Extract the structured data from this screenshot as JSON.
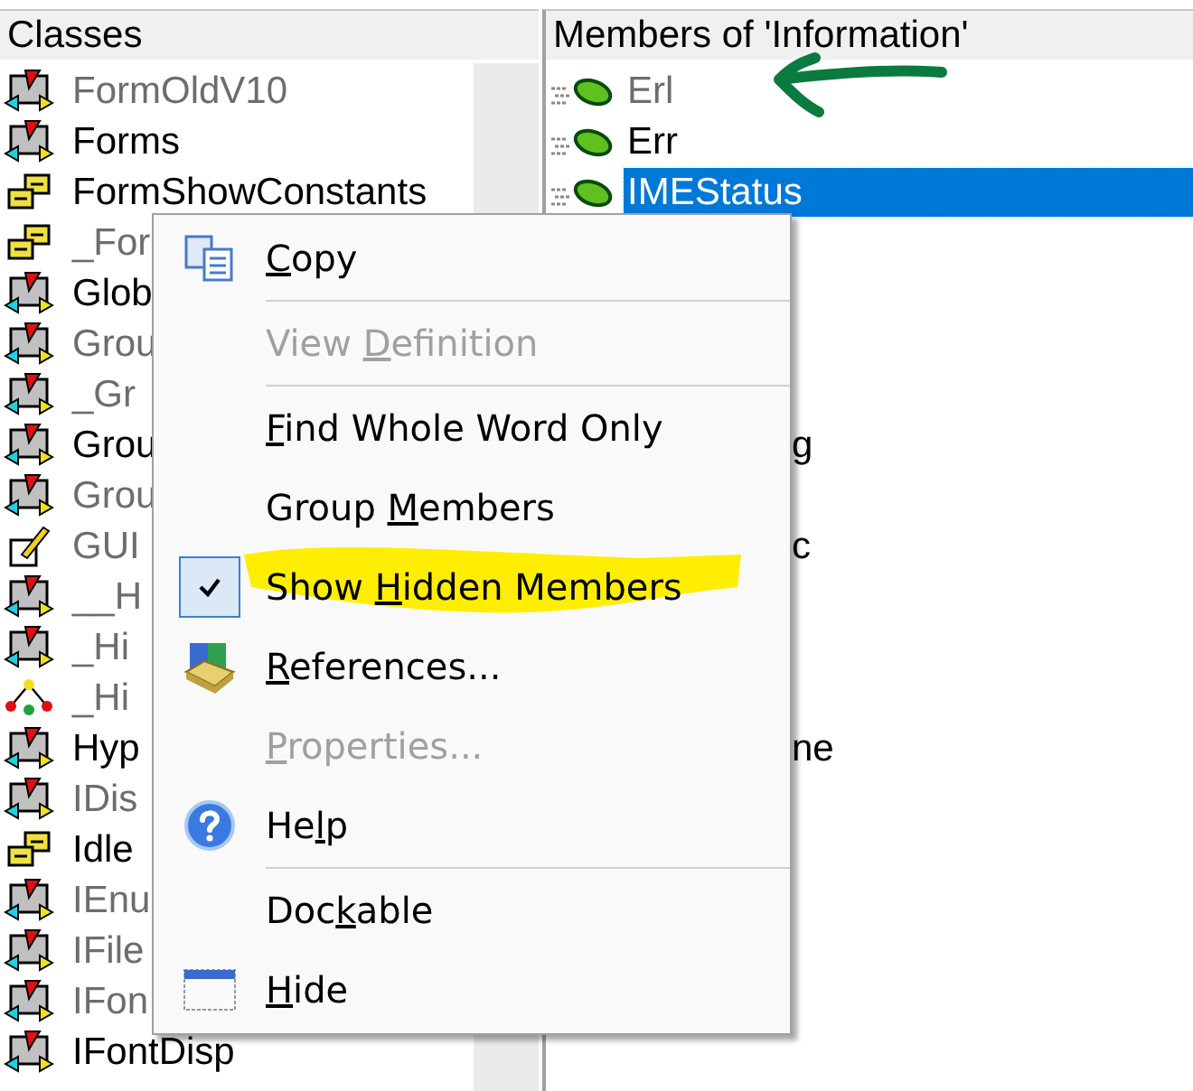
{
  "classes": {
    "header": "Classes",
    "items": [
      {
        "name": "FormOldV10",
        "kind": "class",
        "hidden": true
      },
      {
        "name": "Forms",
        "kind": "class",
        "hidden": false
      },
      {
        "name": "FormShowConstants",
        "kind": "enum",
        "hidden": false
      },
      {
        "name": "_For",
        "kind": "enum",
        "hidden": true
      },
      {
        "name": "Glob",
        "kind": "class",
        "hidden": false
      },
      {
        "name": "Grou",
        "kind": "class",
        "hidden": true
      },
      {
        "name": "_Gr",
        "kind": "class",
        "hidden": true
      },
      {
        "name": "Grou",
        "kind": "class",
        "hidden": false
      },
      {
        "name": "Grou",
        "kind": "class",
        "hidden": true
      },
      {
        "name": "GUI",
        "kind": "module",
        "hidden": true
      },
      {
        "name": "__H",
        "kind": "class",
        "hidden": true
      },
      {
        "name": "_Hi",
        "kind": "class",
        "hidden": true
      },
      {
        "name": "_Hi",
        "kind": "type",
        "hidden": true
      },
      {
        "name": "Hyp",
        "kind": "class",
        "hidden": false
      },
      {
        "name": "IDis",
        "kind": "class",
        "hidden": true
      },
      {
        "name": "Idle",
        "kind": "enum",
        "hidden": false
      },
      {
        "name": "IEnu",
        "kind": "class",
        "hidden": true
      },
      {
        "name": "IFile",
        "kind": "class",
        "hidden": true
      },
      {
        "name": "IFon",
        "kind": "class",
        "hidden": true
      },
      {
        "name": "IFontDisp",
        "kind": "class",
        "hidden": false
      }
    ]
  },
  "members": {
    "header": "Members of 'Information'",
    "items": [
      {
        "name": "Erl",
        "kind": "full",
        "hidden": true,
        "selected": false
      },
      {
        "name": "Err",
        "kind": "full",
        "hidden": false,
        "selected": false
      },
      {
        "name": "IMEStatus",
        "kind": "full",
        "hidden": false,
        "selected": true
      },
      {
        "name": "g",
        "kind": "fragment",
        "hidden": false,
        "selected": false
      },
      {
        "name": "c",
        "kind": "fragment",
        "hidden": false,
        "selected": false
      },
      {
        "name": "ne",
        "kind": "fragment",
        "hidden": false,
        "selected": false
      }
    ]
  },
  "context_menu": {
    "items": [
      {
        "kind": "item",
        "key": "C",
        "post": "opy",
        "disabled": false,
        "checked": false
      },
      {
        "kind": "separator"
      },
      {
        "kind": "item",
        "pre": "View ",
        "key": "D",
        "post": "efinition",
        "disabled": true,
        "checked": false
      },
      {
        "kind": "separator"
      },
      {
        "kind": "item",
        "key": "F",
        "post": "ind Whole Word Only",
        "disabled": false,
        "checked": false
      },
      {
        "kind": "item",
        "pre": "Group ",
        "key": "M",
        "post": "embers",
        "disabled": false,
        "checked": false
      },
      {
        "kind": "item",
        "pre": "Show ",
        "key": "H",
        "post": "idden Members",
        "disabled": false,
        "checked": true
      },
      {
        "kind": "item",
        "key": "R",
        "post": "eferences...",
        "disabled": false,
        "checked": false
      },
      {
        "kind": "item",
        "key": "P",
        "post": "roperties...",
        "disabled": true,
        "checked": false
      },
      {
        "kind": "item",
        "pre": "He",
        "key": "l",
        "post": "p",
        "disabled": false,
        "checked": false
      },
      {
        "kind": "separator"
      },
      {
        "kind": "item",
        "pre": "Doc",
        "key": "k",
        "post": "able",
        "disabled": false,
        "checked": false
      },
      {
        "kind": "item",
        "key": "H",
        "post": "ide",
        "disabled": false,
        "checked": false
      }
    ]
  }
}
